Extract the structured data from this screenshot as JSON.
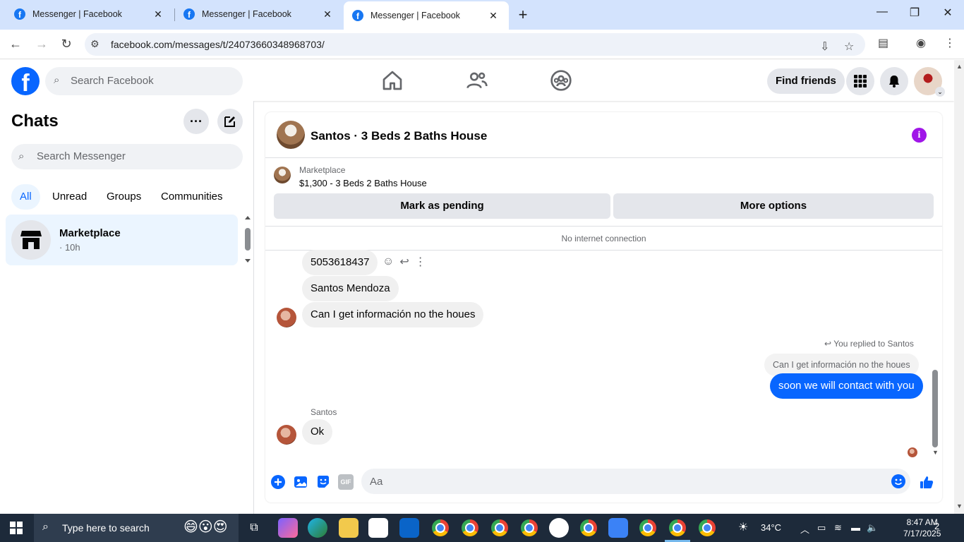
{
  "browser": {
    "tabs": [
      {
        "title": "Messenger | Facebook"
      },
      {
        "title": "Messenger | Facebook"
      },
      {
        "title": "Messenger | Facebook"
      }
    ],
    "tab_close": "✕",
    "new_tab": "+",
    "url": "facebook.com/messages/t/24073660348968703/"
  },
  "fb_header": {
    "logo_letter": "f",
    "search_placeholder": "Search Facebook",
    "find_friends": "Find friends"
  },
  "sidebar": {
    "title": "Chats",
    "search_placeholder": "Search Messenger",
    "filters": [
      "All",
      "Unread",
      "Groups",
      "Communities"
    ],
    "chats": [
      {
        "name": "Marketplace",
        "time": "· 10h"
      }
    ]
  },
  "conversation": {
    "title": "Santos · 3 Beds 2 Baths House",
    "marketplace_label": "Marketplace",
    "listing": "$1,300 - 3 Beds 2 Baths House",
    "mark_pending": "Mark as pending",
    "more_options": "More options",
    "status": "No internet connection",
    "messages": {
      "m1": "5053618437",
      "m2": "Santos Mendoza",
      "m3": "Can I get información no the houes",
      "reply_note": "You replied to Santos",
      "quoted": "Can I get información no the houes",
      "reply": "soon we will contact with you",
      "sender": "Santos",
      "m4": "Ok"
    },
    "composer_placeholder": "Aa",
    "gif_label": "GIF"
  },
  "taskbar": {
    "search_placeholder": "Type here to search",
    "weather": "34°C",
    "time": "8:47 AM",
    "date": "7/17/2025",
    "notifications": "2"
  }
}
